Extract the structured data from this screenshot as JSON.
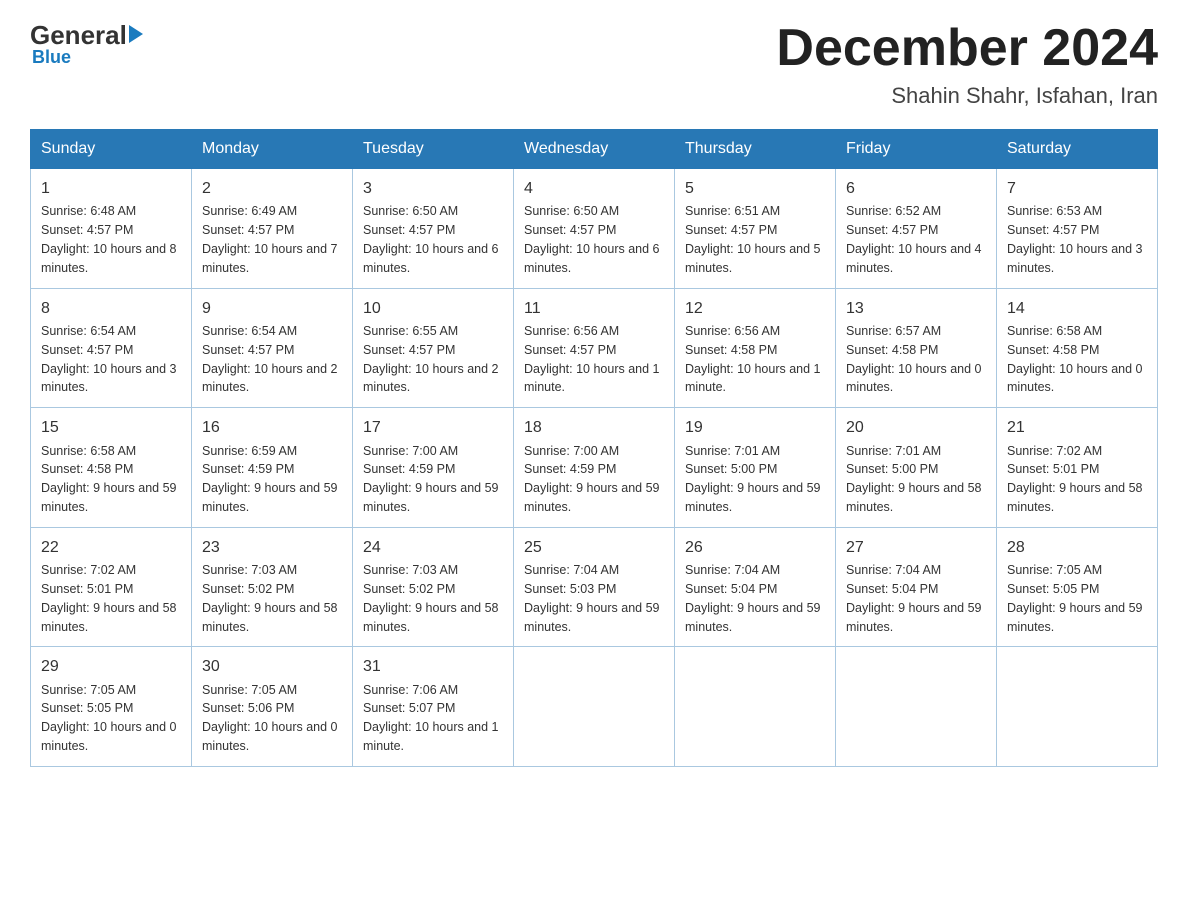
{
  "logo": {
    "general": "General",
    "triangle": "",
    "blue": "Blue"
  },
  "title": "December 2024",
  "location": "Shahin Shahr, Isfahan, Iran",
  "days_header": [
    "Sunday",
    "Monday",
    "Tuesday",
    "Wednesday",
    "Thursday",
    "Friday",
    "Saturday"
  ],
  "weeks": [
    [
      {
        "num": "1",
        "sunrise": "6:48 AM",
        "sunset": "4:57 PM",
        "daylight": "10 hours and 8 minutes."
      },
      {
        "num": "2",
        "sunrise": "6:49 AM",
        "sunset": "4:57 PM",
        "daylight": "10 hours and 7 minutes."
      },
      {
        "num": "3",
        "sunrise": "6:50 AM",
        "sunset": "4:57 PM",
        "daylight": "10 hours and 6 minutes."
      },
      {
        "num": "4",
        "sunrise": "6:50 AM",
        "sunset": "4:57 PM",
        "daylight": "10 hours and 6 minutes."
      },
      {
        "num": "5",
        "sunrise": "6:51 AM",
        "sunset": "4:57 PM",
        "daylight": "10 hours and 5 minutes."
      },
      {
        "num": "6",
        "sunrise": "6:52 AM",
        "sunset": "4:57 PM",
        "daylight": "10 hours and 4 minutes."
      },
      {
        "num": "7",
        "sunrise": "6:53 AM",
        "sunset": "4:57 PM",
        "daylight": "10 hours and 3 minutes."
      }
    ],
    [
      {
        "num": "8",
        "sunrise": "6:54 AM",
        "sunset": "4:57 PM",
        "daylight": "10 hours and 3 minutes."
      },
      {
        "num": "9",
        "sunrise": "6:54 AM",
        "sunset": "4:57 PM",
        "daylight": "10 hours and 2 minutes."
      },
      {
        "num": "10",
        "sunrise": "6:55 AM",
        "sunset": "4:57 PM",
        "daylight": "10 hours and 2 minutes."
      },
      {
        "num": "11",
        "sunrise": "6:56 AM",
        "sunset": "4:57 PM",
        "daylight": "10 hours and 1 minute."
      },
      {
        "num": "12",
        "sunrise": "6:56 AM",
        "sunset": "4:58 PM",
        "daylight": "10 hours and 1 minute."
      },
      {
        "num": "13",
        "sunrise": "6:57 AM",
        "sunset": "4:58 PM",
        "daylight": "10 hours and 0 minutes."
      },
      {
        "num": "14",
        "sunrise": "6:58 AM",
        "sunset": "4:58 PM",
        "daylight": "10 hours and 0 minutes."
      }
    ],
    [
      {
        "num": "15",
        "sunrise": "6:58 AM",
        "sunset": "4:58 PM",
        "daylight": "9 hours and 59 minutes."
      },
      {
        "num": "16",
        "sunrise": "6:59 AM",
        "sunset": "4:59 PM",
        "daylight": "9 hours and 59 minutes."
      },
      {
        "num": "17",
        "sunrise": "7:00 AM",
        "sunset": "4:59 PM",
        "daylight": "9 hours and 59 minutes."
      },
      {
        "num": "18",
        "sunrise": "7:00 AM",
        "sunset": "4:59 PM",
        "daylight": "9 hours and 59 minutes."
      },
      {
        "num": "19",
        "sunrise": "7:01 AM",
        "sunset": "5:00 PM",
        "daylight": "9 hours and 59 minutes."
      },
      {
        "num": "20",
        "sunrise": "7:01 AM",
        "sunset": "5:00 PM",
        "daylight": "9 hours and 58 minutes."
      },
      {
        "num": "21",
        "sunrise": "7:02 AM",
        "sunset": "5:01 PM",
        "daylight": "9 hours and 58 minutes."
      }
    ],
    [
      {
        "num": "22",
        "sunrise": "7:02 AM",
        "sunset": "5:01 PM",
        "daylight": "9 hours and 58 minutes."
      },
      {
        "num": "23",
        "sunrise": "7:03 AM",
        "sunset": "5:02 PM",
        "daylight": "9 hours and 58 minutes."
      },
      {
        "num": "24",
        "sunrise": "7:03 AM",
        "sunset": "5:02 PM",
        "daylight": "9 hours and 58 minutes."
      },
      {
        "num": "25",
        "sunrise": "7:04 AM",
        "sunset": "5:03 PM",
        "daylight": "9 hours and 59 minutes."
      },
      {
        "num": "26",
        "sunrise": "7:04 AM",
        "sunset": "5:04 PM",
        "daylight": "9 hours and 59 minutes."
      },
      {
        "num": "27",
        "sunrise": "7:04 AM",
        "sunset": "5:04 PM",
        "daylight": "9 hours and 59 minutes."
      },
      {
        "num": "28",
        "sunrise": "7:05 AM",
        "sunset": "5:05 PM",
        "daylight": "9 hours and 59 minutes."
      }
    ],
    [
      {
        "num": "29",
        "sunrise": "7:05 AM",
        "sunset": "5:05 PM",
        "daylight": "10 hours and 0 minutes."
      },
      {
        "num": "30",
        "sunrise": "7:05 AM",
        "sunset": "5:06 PM",
        "daylight": "10 hours and 0 minutes."
      },
      {
        "num": "31",
        "sunrise": "7:06 AM",
        "sunset": "5:07 PM",
        "daylight": "10 hours and 1 minute."
      },
      null,
      null,
      null,
      null
    ]
  ]
}
